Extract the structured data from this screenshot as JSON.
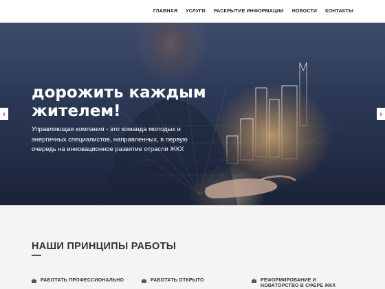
{
  "nav": {
    "items": [
      {
        "label": "ГЛАВНАЯ"
      },
      {
        "label": "УСЛУГИ"
      },
      {
        "label": "РАСКРЫТИЕ ИНФОРМАЦИИ"
      },
      {
        "label": "НОВОСТИ"
      },
      {
        "label": "КОНТАКТЫ"
      }
    ]
  },
  "hero": {
    "title_line1": "дорожить каждым",
    "title_line2": "жителем!",
    "text": "Управляющая компания - это команда молодых и энергичных специалистов, направленных, в первую очередь на инновационное развитие отрасли ЖКХ",
    "prev_icon": "chevron-left-icon",
    "next_icon": "chevron-right-icon"
  },
  "principles": {
    "title": "НАШИ ПРИНЦИПЫ РАБОТЫ",
    "items": [
      {
        "label": "РАБОТАТЬ ПРОФЕССИОНАЛЬНО",
        "icon": "briefcase-icon"
      },
      {
        "label": "РАБОТАТЬ ОТКРЫТО",
        "icon": "briefcase-icon"
      },
      {
        "label_line1": "РЕФОРМИРОВАНИЕ И",
        "label_line2": "НОВАТОРСТВО В СФЕРЕ ЖКХ",
        "icon": "briefcase-icon"
      }
    ]
  },
  "colors": {
    "accent": "#2c3956",
    "glow": "#ffc878",
    "text_dark": "#333333"
  }
}
